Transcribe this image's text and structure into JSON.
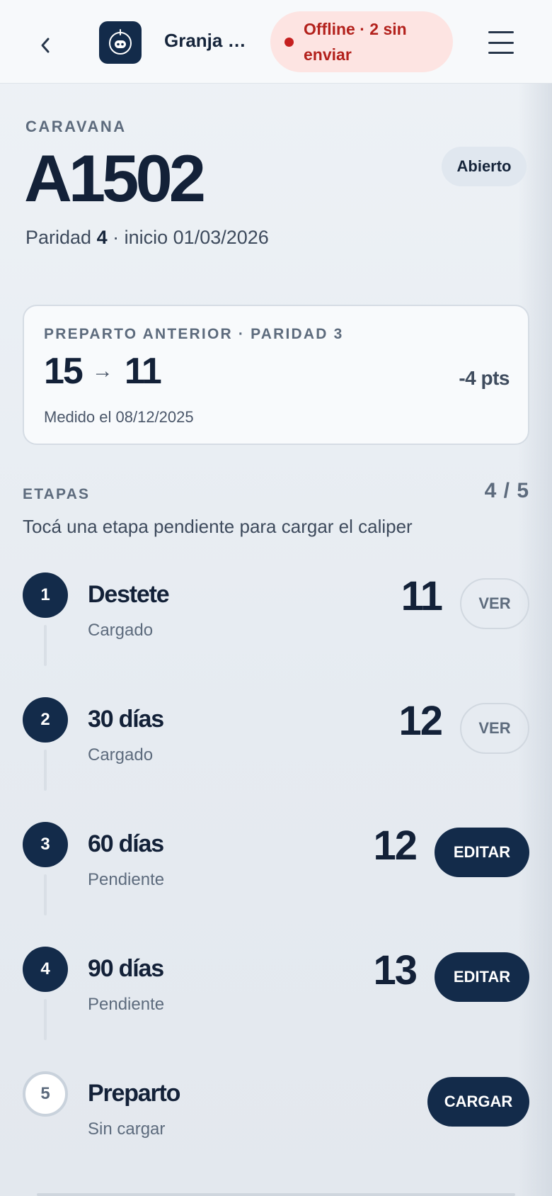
{
  "header": {
    "farm_name": "Granja N...",
    "offline_status": "Offline · 2 sin enviar",
    "back_icon": "chevron-left-icon",
    "menu_icon": "hamburger-menu-icon",
    "logo_icon": "cow-face-icon"
  },
  "animal": {
    "eyebrow": "CARAVANA",
    "id": "A1502",
    "status": "Abierto",
    "parity_label": "Paridad",
    "parity_value": "4",
    "start_text": "· inicio 01/03/2026"
  },
  "previous": {
    "label": "PREPARTO ANTERIOR · PARIDAD 3",
    "from": "15",
    "arrow": "→",
    "to": "11",
    "delta": "-4 pts",
    "measured": "Medido el 08/12/2025"
  },
  "stages": {
    "title": "ETAPAS",
    "count": "4 / 5",
    "hint": "Tocá una etapa pendiente para cargar el caliper",
    "items": [
      {
        "number": "1",
        "name": "Destete",
        "status": "Cargado",
        "value": "11",
        "action": "VER"
      },
      {
        "number": "2",
        "name": "30 días",
        "status": "Cargado",
        "value": "12",
        "action": "VER"
      },
      {
        "number": "3",
        "name": "60 días",
        "status": "Pendiente",
        "value": "12",
        "action": "EDITAR"
      },
      {
        "number": "4",
        "name": "90 días",
        "status": "Pendiente",
        "value": "13",
        "action": "EDITAR"
      },
      {
        "number": "5",
        "name": "Preparto",
        "status": "Sin cargar",
        "value": "",
        "action": "CARGAR"
      }
    ]
  },
  "colors": {
    "primary": "#132b4a",
    "offline_bg": "#fde4e2",
    "offline_text": "#b3211c",
    "muted": "#5d6b7d"
  }
}
